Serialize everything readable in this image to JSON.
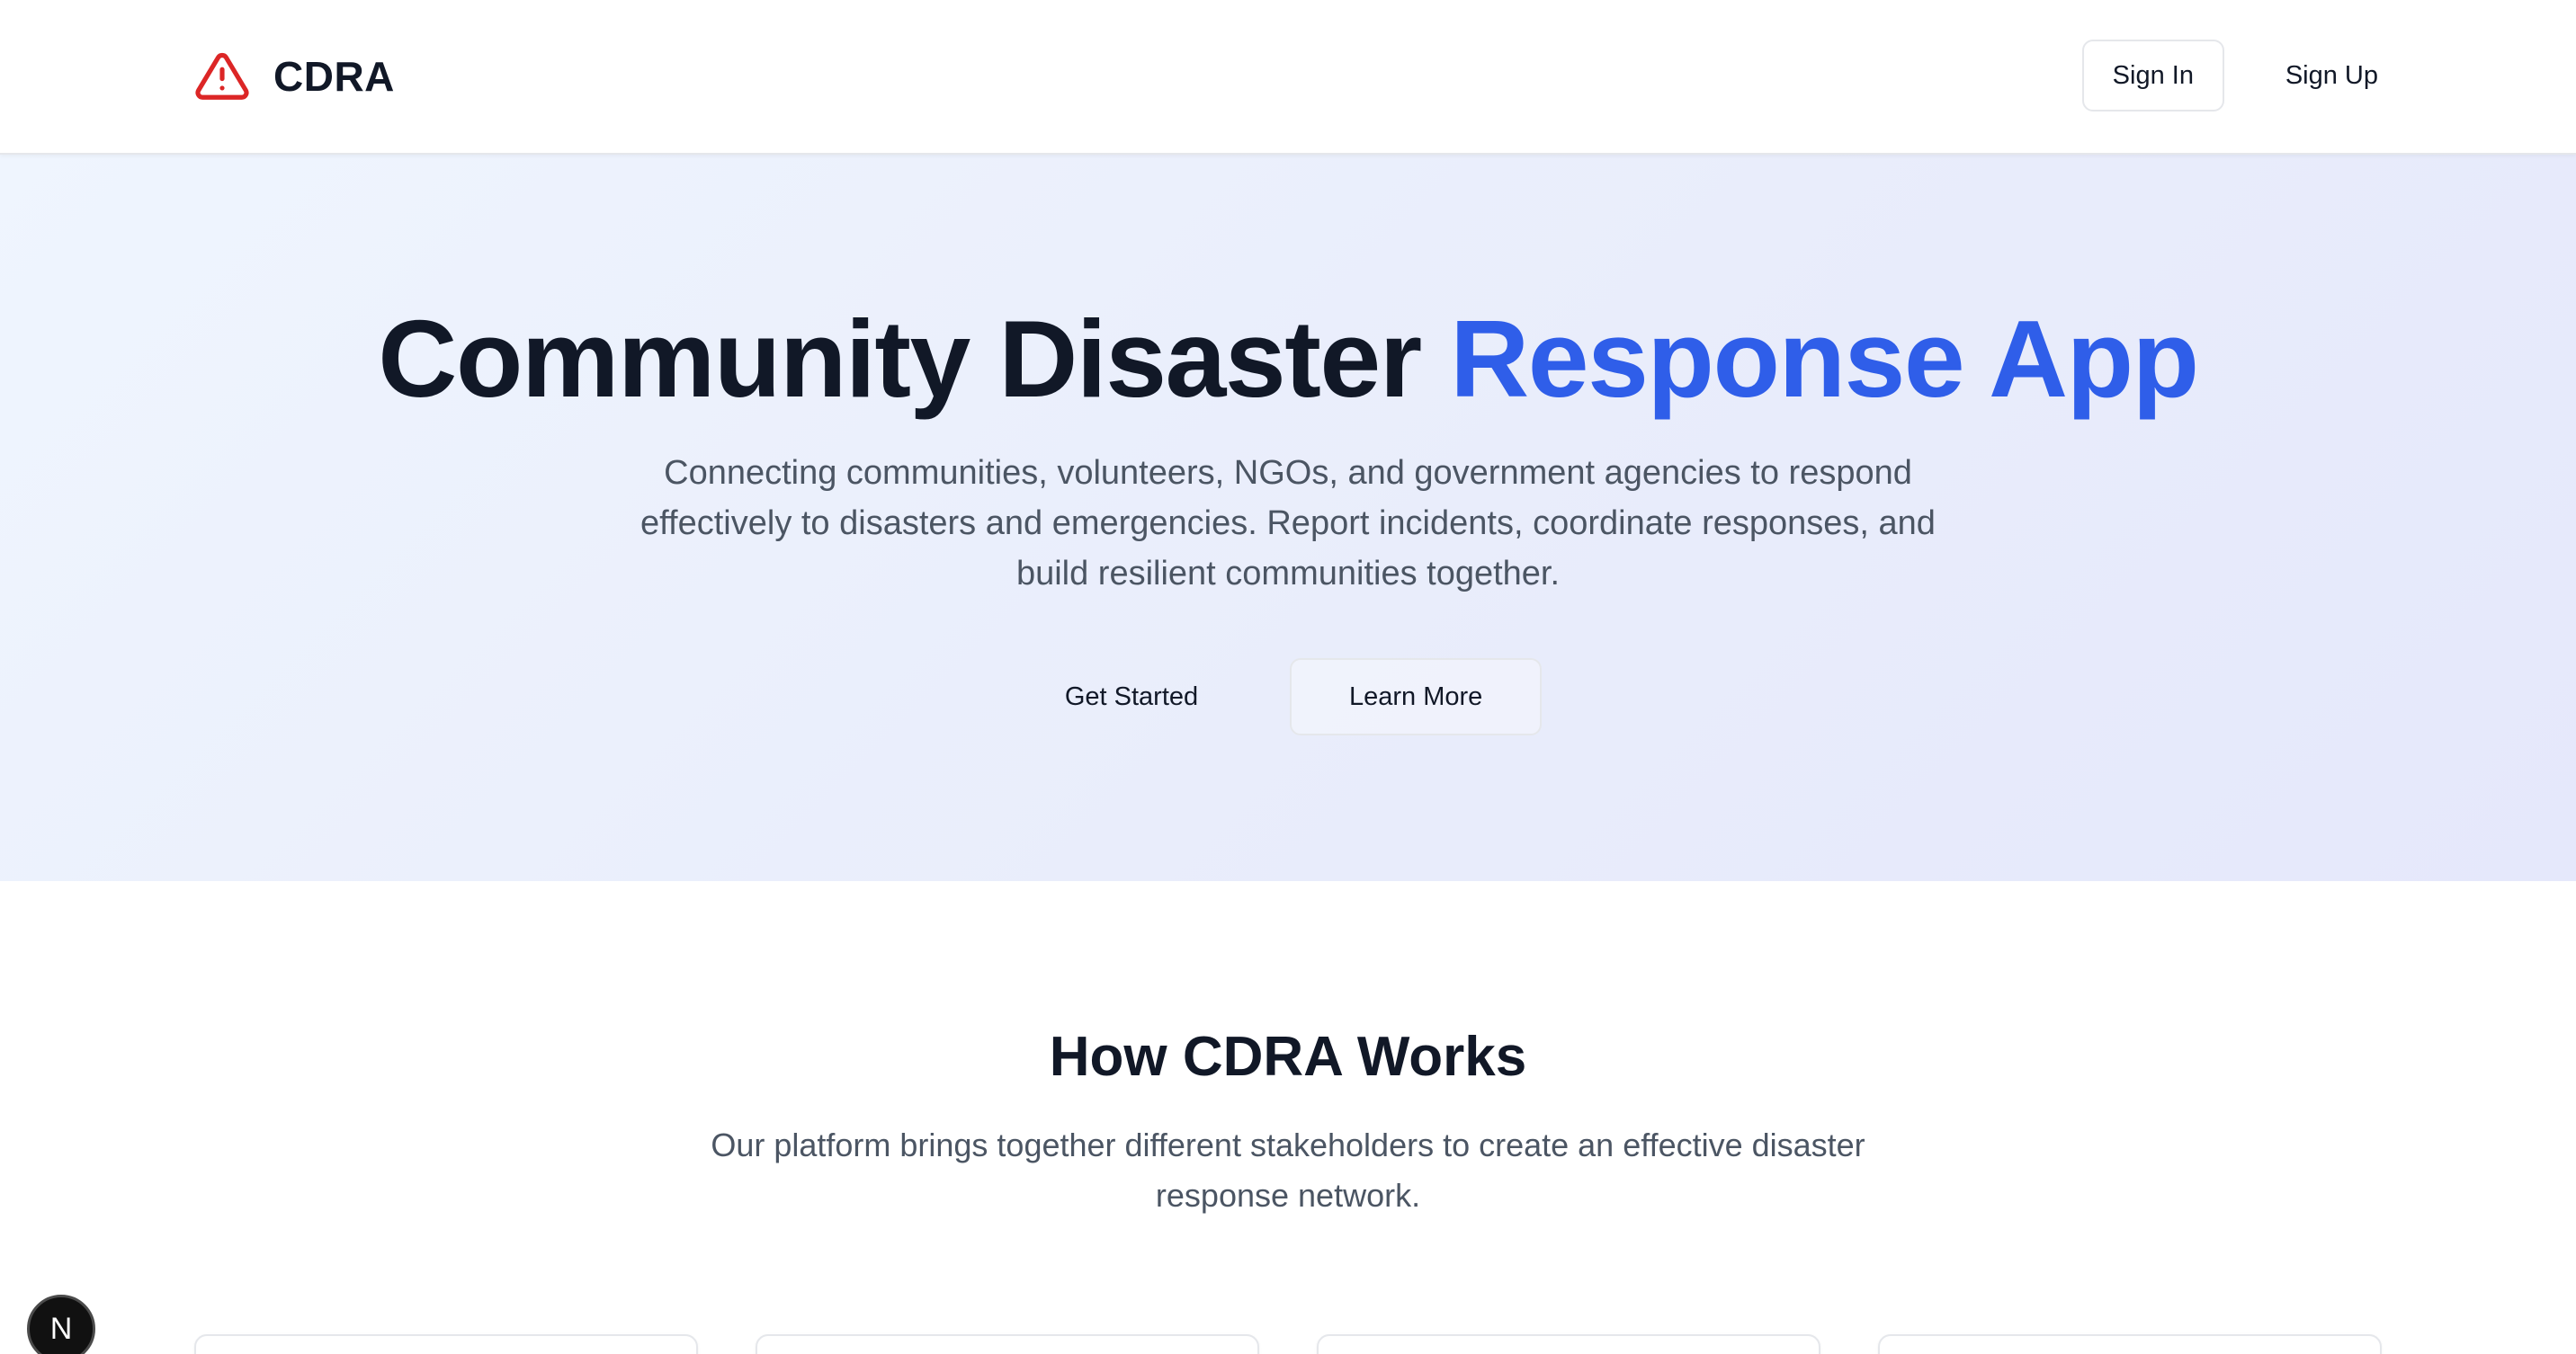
{
  "header": {
    "brand_name": "CDRA",
    "brand_icon": "warning-triangle-icon",
    "signin_label": "Sign In",
    "signup_label": "Sign Up"
  },
  "hero": {
    "title_main": "Community Disaster ",
    "title_accent": "Response App",
    "description": "Connecting communities, volunteers, NGOs, and government agencies to respond effectively to disasters and emergencies. Report incidents, coordinate responses, and build resilient communities together.",
    "get_started_label": "Get Started",
    "learn_more_label": "Learn More"
  },
  "how": {
    "title": "How CDRA Works",
    "description": "Our platform brings together different stakeholders to create an effective disaster response network."
  },
  "dev_badge": {
    "label": "N"
  },
  "colors": {
    "accent": "#2f5ee9",
    "brand_icon": "#dc2626",
    "text": "#111827",
    "muted": "#4b5563"
  }
}
